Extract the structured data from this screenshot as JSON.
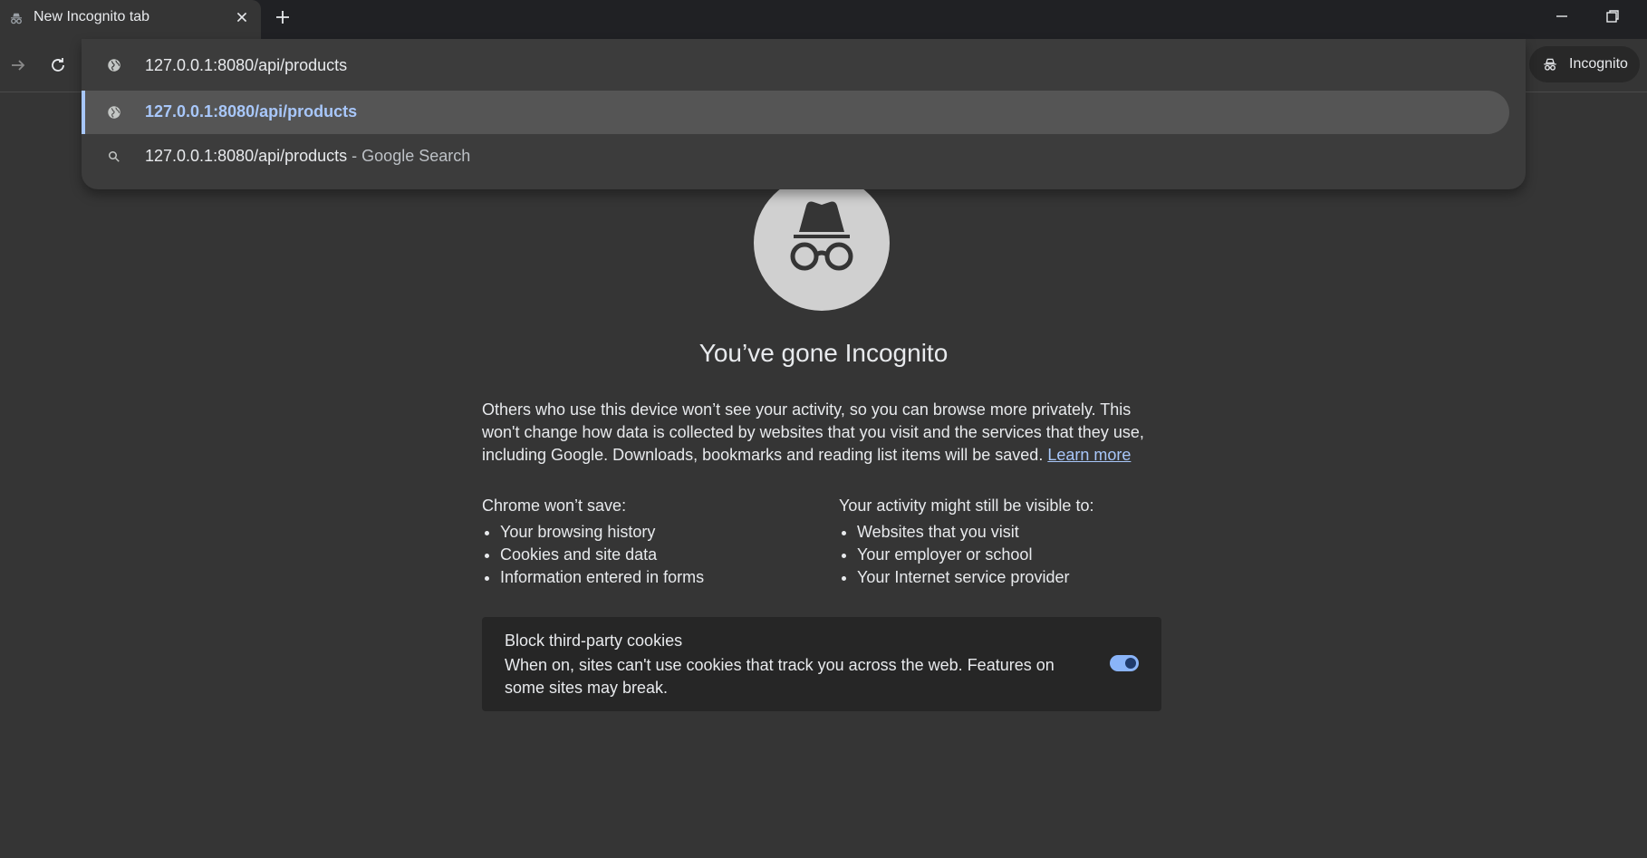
{
  "window": {
    "tab_title": "New Incognito tab",
    "tab_close_icon": "close-icon",
    "new_tab_icon": "plus-icon"
  },
  "toolbar": {
    "forward_icon": "arrow-forward-icon",
    "reload_icon": "reload-icon",
    "incognito_label": "Incognito"
  },
  "omnibox": {
    "value": "127.0.0.1:8080/api/products",
    "suggestions": [
      {
        "icon": "globe-icon",
        "text": "127.0.0.1:8080/api/products",
        "selected": true
      },
      {
        "icon": "search-icon",
        "text": "127.0.0.1:8080/api/products",
        "suffix": " - Google Search"
      }
    ]
  },
  "page": {
    "title": "You’ve gone Incognito",
    "intro": "Others who use this device won’t see your activity, so you can browse more privately. This won't change how data is collected by websites that you visit and the services that they use, including Google. Downloads, bookmarks and reading list items will be saved.",
    "learn_more": "Learn more",
    "wont_save_heading": "Chrome won’t save:",
    "wont_save_items": [
      "Your browsing history",
      "Cookies and site data",
      "Information entered in forms"
    ],
    "visible_heading": "Your activity might still be visible to:",
    "visible_items": [
      "Websites that you visit",
      "Your employer or school",
      "Your Internet service provider"
    ],
    "cookie_title": "Block third-party cookies",
    "cookie_desc": "When on, sites can't use cookies that track you across the web. Features on some sites may break.",
    "cookie_toggle_on": true
  },
  "colors": {
    "accent": "#a8c7fa",
    "background": "#353535",
    "card": "#262626"
  }
}
